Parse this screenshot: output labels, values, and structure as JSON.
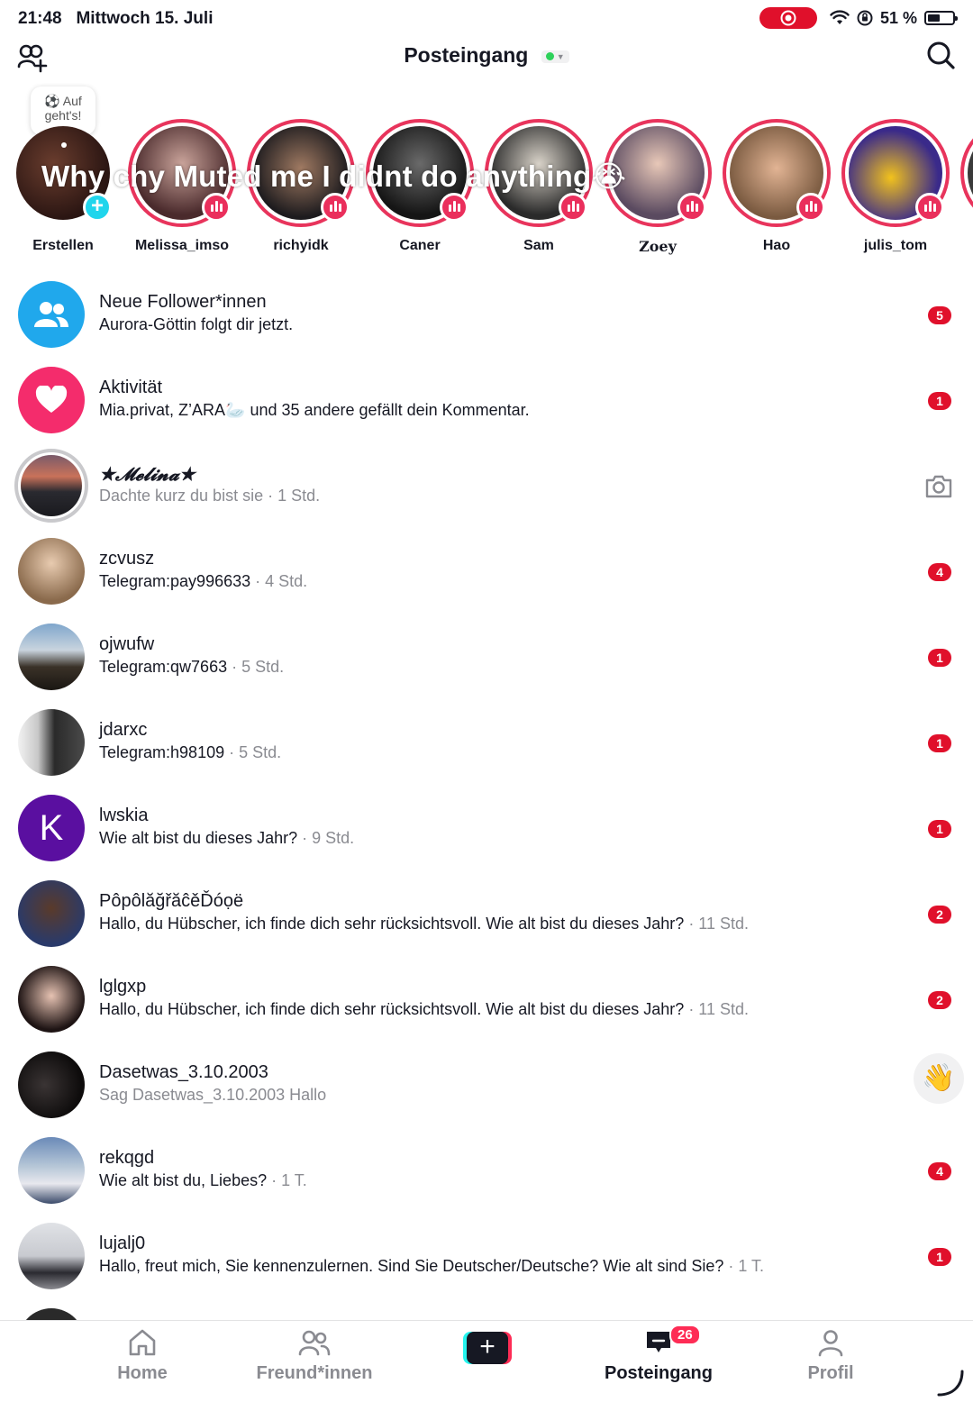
{
  "status_bar": {
    "time": "21:48",
    "date": "Mittwoch 15. Juli",
    "battery": "51 %",
    "battery_level": 0.51,
    "icons": [
      "screen-record-icon",
      "wifi-icon",
      "orientation-lock-icon",
      "battery-icon"
    ]
  },
  "header": {
    "title": "Posteingang",
    "left_icon": "add-friend-icon",
    "right_icon": "search-icon"
  },
  "stories": {
    "create_bubble_line1": "⚽ Auf",
    "create_bubble_line2": "geht's!",
    "overlay_text": "Why chy Muted me I didnt do anything😭",
    "items": [
      {
        "name": "Erstellen"
      },
      {
        "name": "Melissa_imso"
      },
      {
        "name": "richyidk"
      },
      {
        "name": "Caner"
      },
      {
        "name": "Sam"
      },
      {
        "name": "Zoey"
      },
      {
        "name": "Hao"
      },
      {
        "name": "julis_tom"
      }
    ]
  },
  "inbox": {
    "rows": [
      {
        "title": "Neue Follower*innen",
        "subtitle": "Aurora-Göttin folgt dir jetzt.",
        "time": "",
        "badge": "5"
      },
      {
        "title": "Aktivität",
        "subtitle": "Mia.privat, Z’ARA🦢 und 35 andere gefällt dein Kommentar.",
        "time": "",
        "badge": "1"
      },
      {
        "title": "★𝓜𝓮𝓵𝓲𝓷𝓪★",
        "subtitle": "Dachte kurz du bist sie",
        "time": " · 1 Std.",
        "badge": ""
      },
      {
        "title": "zcvusz",
        "subtitle": "Telegram:pay996633",
        "time": " · 4 Std.",
        "badge": "4"
      },
      {
        "title": "ojwufw",
        "subtitle": "Telegram:qw7663",
        "time": " · 5 Std.",
        "badge": "1"
      },
      {
        "title": "jdarxc",
        "subtitle": "Telegram:h98109",
        "time": " · 5 Std.",
        "badge": "1"
      },
      {
        "title": "lwskia",
        "subtitle": "Wie alt bist du dieses Jahr?",
        "time": " · 9 Std.",
        "badge": "1",
        "initial": "K"
      },
      {
        "title": "PôpôlăğřăĉěĎóọë",
        "subtitle": "Hallo, du Hübscher, ich finde dich sehr rücksichtsvoll. Wie alt bist du dieses Jahr?",
        "time": " · 11 Std.",
        "badge": "2"
      },
      {
        "title": "lglgxp",
        "subtitle": "Hallo, du Hübscher, ich finde dich sehr rücksichtsvoll. Wie alt bist du dieses Jahr?",
        "time": " · 11 Std.",
        "badge": "2"
      },
      {
        "title": "Dasetwas_3.10.2003",
        "subtitle": "Sag Dasetwas_3.10.2003 Hallo",
        "time": "",
        "badge": "",
        "action": "👋"
      },
      {
        "title": "rekqgd",
        "subtitle": "Wie alt bist du, Liebes?",
        "time": " · 1 T.",
        "badge": "4"
      },
      {
        "title": "lujalj0",
        "subtitle": "Hallo, freut mich, Sie kennenzulernen. Sind Sie Deutscher/Deutsche? Wie alt sind Sie?",
        "time": " · 1 T.",
        "badge": "1"
      }
    ]
  },
  "tabbar": {
    "home": "Home",
    "friends": "Freund*innen",
    "create": "+",
    "inbox": "Posteingang",
    "inbox_badge": "26",
    "profile": "Profil"
  },
  "colors": {
    "accent_red": "#fe2c55",
    "badge_red": "#e0102b",
    "followers_blue": "#20a8ec",
    "activity_pink": "#f42c6c",
    "story_ring": "#e8345c",
    "online_green": "#2ed15a"
  }
}
